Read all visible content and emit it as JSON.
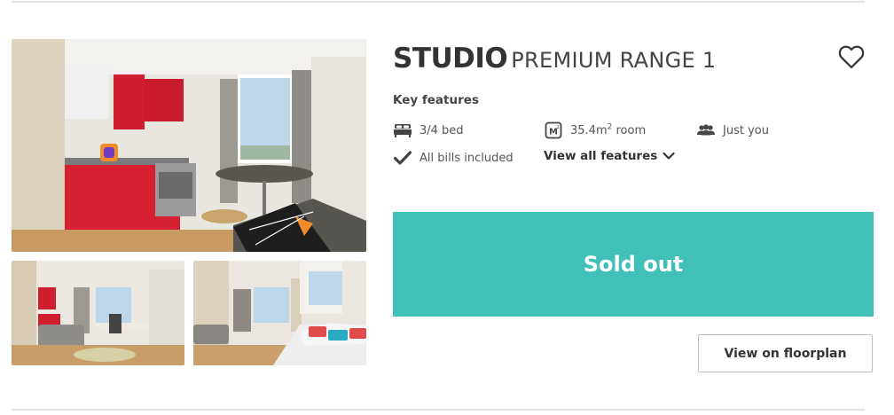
{
  "room": {
    "type": "STUDIO",
    "range": "PREMIUM RANGE 1"
  },
  "key_features": {
    "heading": "Key features",
    "bed": "3/4 bed",
    "size_value": "35.4m",
    "size_sup": "2",
    "size_suffix": " room",
    "occupancy": "Just you",
    "bills": "All bills included",
    "view_all": "View all features"
  },
  "actions": {
    "status": "Sold out",
    "floorplan": "View on floorplan"
  },
  "icons": {
    "favourite": "heart-outline-icon",
    "bed": "bed-icon",
    "size": "room-size-icon",
    "occupancy": "people-icon",
    "bills": "checkmark-icon",
    "expand": "chevron-down-icon"
  },
  "colors": {
    "status_button": "#40c0b9",
    "text": "#333333",
    "divider": "#e3e3e3"
  }
}
